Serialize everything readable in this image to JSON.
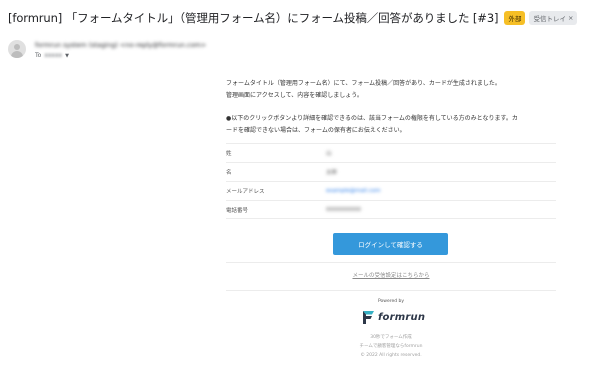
{
  "email": {
    "subject": "[formrun] 「フォームタイトル」（管理用フォーム名）にフォーム投稿／回答がありました [#3]",
    "badge_external": "外部",
    "badge_inbox": "受信トレイ",
    "badge_close": "×",
    "sender": "formrun system (staging) <no-reply@formrun.com>",
    "to_prefix": "To",
    "to_name": "xxxxx",
    "to_caret": "▼"
  },
  "body": {
    "intro_line1": "フォームタイトル（管理用フォーム名）にて、フォーム投稿／回答があり、カードが生成されました。",
    "intro_line2": "管理画面にアクセスして、内容を確認しましょう。",
    "notice_line1": "●以下のクリックボタンより詳細を確認できるのは、該当フォームの権限を有している方のみとなります。カ",
    "notice_line2": "ードを確認できない場合は、フォームの保有者にお伝えください。",
    "fields": [
      {
        "label": "姓",
        "value": "山"
      },
      {
        "label": "名",
        "value": "太郎"
      },
      {
        "label": "メールアドレス",
        "value": "example@mail.com"
      },
      {
        "label": "電話番号",
        "value": "0000000000"
      }
    ],
    "login_button": "ログインして確認する",
    "unsubscribe_link": "メールの受信設定はこちらから"
  },
  "footer": {
    "powered_by": "Powered by",
    "brand": "formrun",
    "line1": "30秒でフォーム作成",
    "line2": "チームで顧客管理ならformrun",
    "line3": "© 2022 All rights reserved."
  },
  "colors": {
    "button": "#3498db",
    "badge_external": "#f6bf26",
    "link": "#1a73e8"
  }
}
